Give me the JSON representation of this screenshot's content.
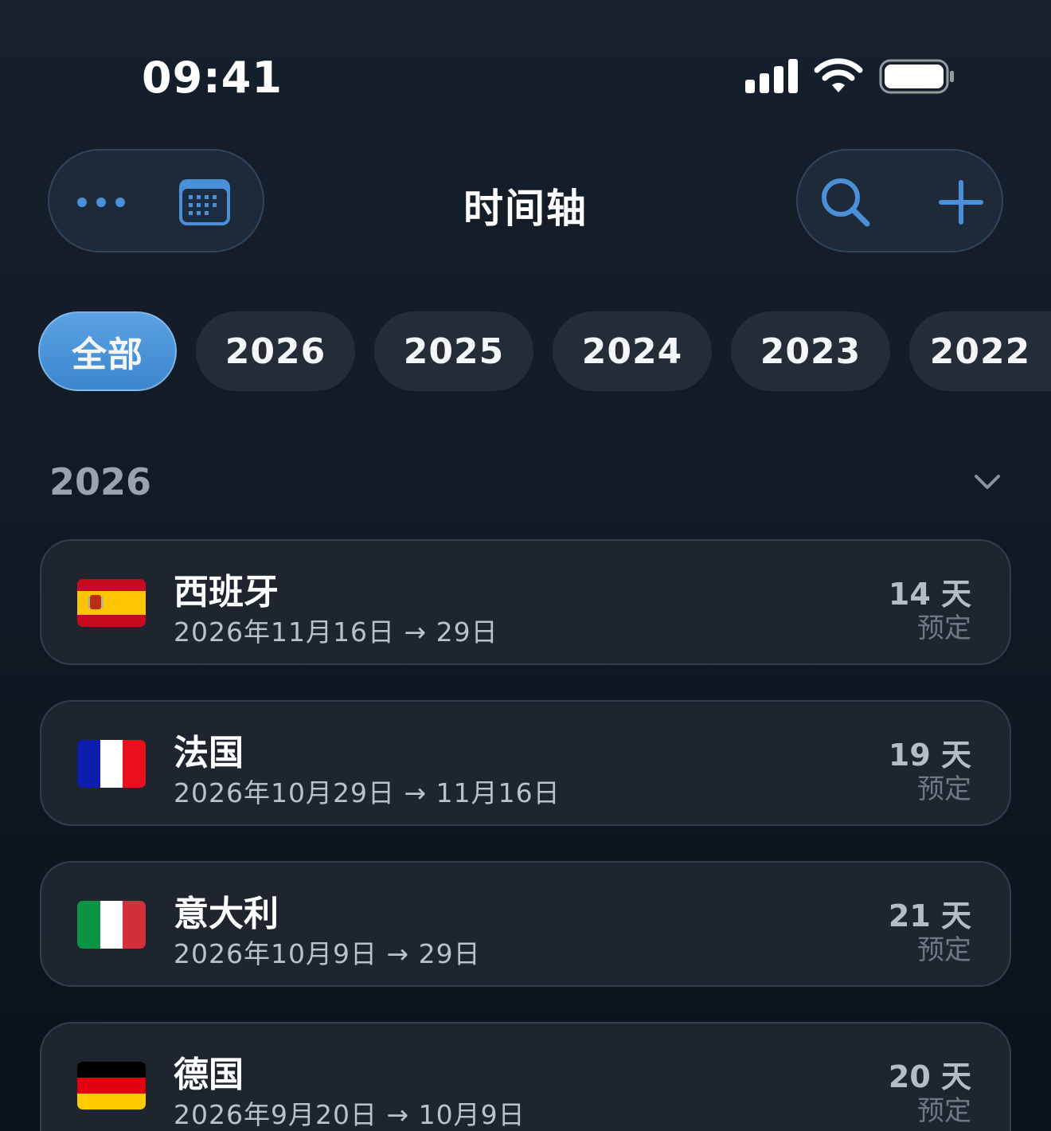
{
  "status_bar": {
    "time": "09:41"
  },
  "header": {
    "title": "时间轴",
    "left_icons": [
      "more-icon",
      "calendar-icon"
    ],
    "right_icons": [
      "search-icon",
      "plus-icon"
    ],
    "accent": "#4a90d9"
  },
  "filters": [
    {
      "label": "全部",
      "active": true
    },
    {
      "label": "2026",
      "active": false
    },
    {
      "label": "2025",
      "active": false
    },
    {
      "label": "2024",
      "active": false
    },
    {
      "label": "2023",
      "active": false
    },
    {
      "label": "2022",
      "active": false
    }
  ],
  "section": {
    "title": "2026",
    "icon": "chevron-down-icon"
  },
  "trips": [
    {
      "country": "西班牙",
      "flag": "spain-flag-icon",
      "dates": "2026年11月16日 → 29日",
      "days": "14 天",
      "status": "预定"
    },
    {
      "country": "法国",
      "flag": "france-flag-icon",
      "dates": "2026年10月29日 → 11月16日",
      "days": "19 天",
      "status": "预定"
    },
    {
      "country": "意大利",
      "flag": "italy-flag-icon",
      "dates": "2026年10月9日 → 29日",
      "days": "21 天",
      "status": "预定"
    },
    {
      "country": "德国",
      "flag": "germany-flag-icon",
      "dates": "2026年9月20日 → 10月9日",
      "days": "20 天",
      "status": "预定"
    }
  ]
}
